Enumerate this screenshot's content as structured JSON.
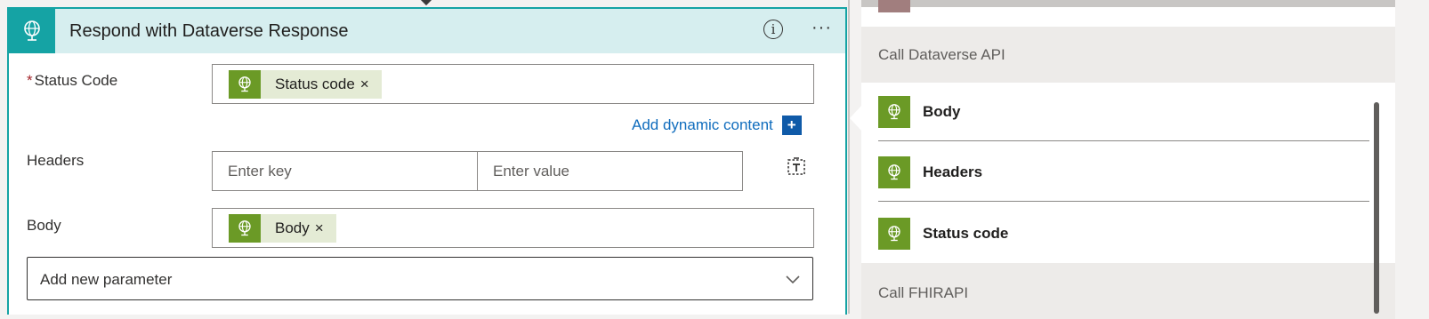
{
  "action_card": {
    "title": "Respond with Dataverse Response",
    "info_symbol": "i",
    "more_symbol": "···",
    "colors": {
      "accent": "#15a3a4",
      "header_bg": "#d6eeef",
      "token_icon_bg": "#6b9a26",
      "token_bg": "#e4ebd5"
    }
  },
  "fields": {
    "status_code": {
      "required_marker": "*",
      "label": "Status Code",
      "token_label": "Status code",
      "remove_symbol": "×"
    },
    "add_dynamic_content": {
      "label": "Add dynamic content",
      "plus_symbol": "+"
    },
    "headers": {
      "label": "Headers",
      "key_placeholder": "Enter key",
      "value_placeholder": "Enter value"
    },
    "body": {
      "label": "Body",
      "token_label": "Body",
      "remove_symbol": "×"
    },
    "add_new_parameter": {
      "label": "Add new parameter"
    }
  },
  "dynamic_panel": {
    "groups": [
      {
        "title": "Call Dataverse API",
        "items": [
          {
            "label": "Body",
            "icon": "globe-icon"
          },
          {
            "label": "Headers",
            "icon": "globe-icon"
          },
          {
            "label": "Status code",
            "icon": "globe-icon"
          }
        ]
      },
      {
        "title": "Call FHIRAPI",
        "items": []
      }
    ]
  }
}
